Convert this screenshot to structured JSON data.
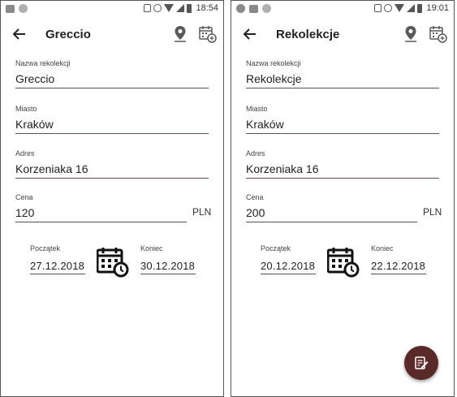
{
  "screens": [
    {
      "status_bar": {
        "time": "18:54"
      },
      "toolbar": {
        "title": "Greccio",
        "back_icon": "arrow-back-icon",
        "location_icon": "map-pin-icon",
        "calendar_icon": "calendar-add-icon"
      },
      "form": {
        "name": {
          "label": "Nazwa rekolekcji",
          "value": "Greccio"
        },
        "city": {
          "label": "Miasto",
          "value": "Kraków"
        },
        "address": {
          "label": "Adres",
          "value": "Korzeniaka 16"
        },
        "price": {
          "label": "Cena",
          "value": "120",
          "currency": "PLN"
        },
        "start": {
          "label": "Początek",
          "value": "27.12.2018"
        },
        "end": {
          "label": "Koniec",
          "value": "30.12.2018"
        }
      },
      "has_fab": false
    },
    {
      "status_bar": {
        "time": "19:01"
      },
      "toolbar": {
        "title": "Rekolekcje",
        "back_icon": "arrow-back-icon",
        "location_icon": "map-pin-icon",
        "calendar_icon": "calendar-add-icon"
      },
      "form": {
        "name": {
          "label": "Nazwa rekolekcji",
          "value": "Rekolekcje"
        },
        "city": {
          "label": "Miasto",
          "value": "Kraków"
        },
        "address": {
          "label": "Adres",
          "value": "Korzeniaka 16"
        },
        "price": {
          "label": "Cena",
          "value": "200",
          "currency": "PLN"
        },
        "start": {
          "label": "Początek",
          "value": "20.12.2018"
        },
        "end": {
          "label": "Koniec",
          "value": "22.12.2018"
        }
      },
      "has_fab": true,
      "fab_icon": "edit-note-icon"
    }
  ],
  "colors": {
    "accent": "#5a2a2a",
    "underline": "#6b4a4a"
  }
}
